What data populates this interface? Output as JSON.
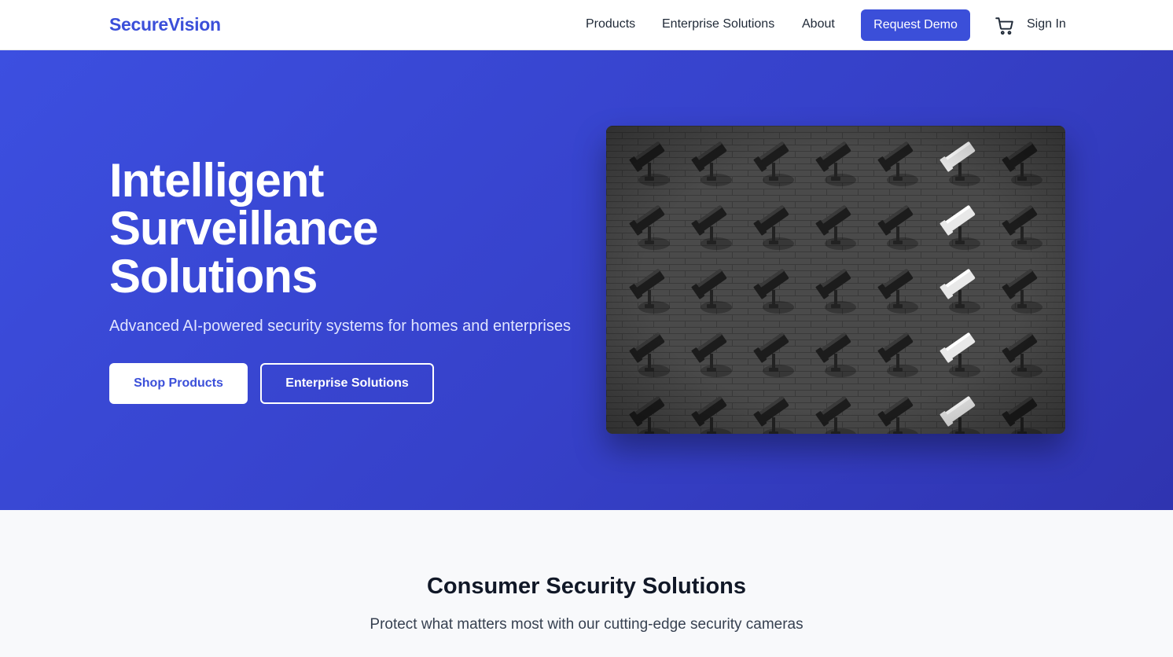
{
  "nav": {
    "logo": "SecureVision",
    "links": [
      "Products",
      "Enterprise Solutions",
      "About"
    ],
    "demo_label": "Request Demo",
    "cart_icon": "cart-icon",
    "signin_label": "Sign In"
  },
  "hero": {
    "title_lines": [
      "Intelligent",
      "Surveillance",
      "Solutions"
    ],
    "subtitle": "Advanced AI-powered security systems for homes and enterprises",
    "primary_cta": "Shop Products",
    "secondary_cta": "Enterprise Solutions",
    "image_subject": "wall of security cameras"
  },
  "section": {
    "title": "Consumer Security Solutions",
    "subtitle": "Protect what matters most with our cutting-edge security cameras"
  },
  "colors": {
    "accent": "#3b4fd9",
    "hero_gradient_start": "#3c4fe0",
    "hero_gradient_end": "#2f34b0"
  }
}
